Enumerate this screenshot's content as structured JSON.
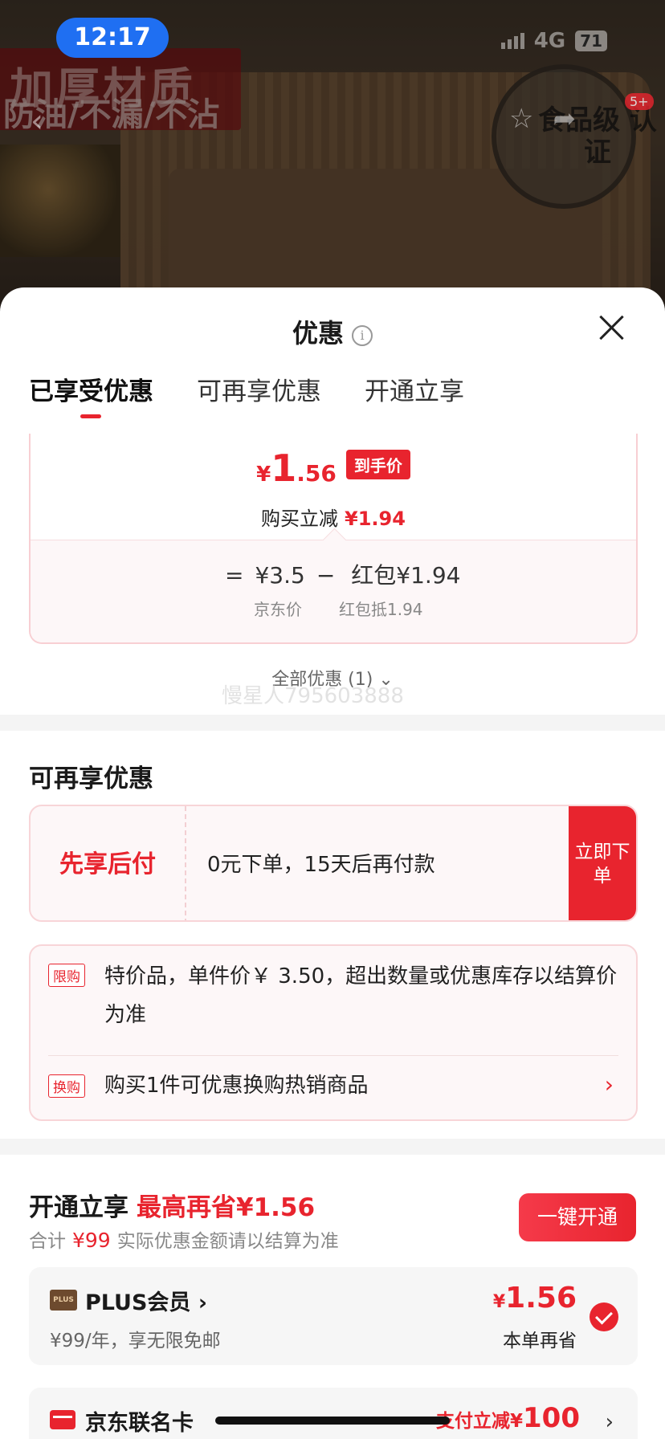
{
  "status_bar": {
    "time": "12:17",
    "network": "4G",
    "battery": "71"
  },
  "product_bg": {
    "banner_line1": "加厚材质",
    "banner_line2": "防油/不漏/不沾",
    "seal_text": "食品级 认证",
    "cart_badge": "5+"
  },
  "sheet": {
    "title": "优惠",
    "tabs": [
      "已享受优惠",
      "可再享优惠",
      "开通立享"
    ]
  },
  "price_card": {
    "currency": "¥",
    "price_int": "1",
    "price_dec": ".56",
    "price_tag": "到手价",
    "reduce_label": "购买立减",
    "reduce_value": "¥1.94",
    "formula_eq": "=",
    "formula_base": "¥3.5",
    "formula_minus": "−",
    "formula_redpacket_label": "红包",
    "formula_redpacket_value": "¥1.94",
    "sub_jd_price": "京东价",
    "sub_redpacket": "红包抵1.94"
  },
  "all_discount": "全部优惠 (1)",
  "watermark": "慢星人795603888",
  "more_discount": {
    "title": "可再享优惠",
    "paylater_label": "先享后付",
    "paylater_desc": "0元下单，15天后再付款",
    "paylater_btn": "立即下单",
    "tag_limit": "限购",
    "limit_text": "特价品，单件价￥ 3.50，超出数量或优惠库存以结算价为准",
    "tag_exchange": "换购",
    "exchange_text": "购买1件可优惠换购热销商品"
  },
  "open_section": {
    "title": "开通立享",
    "save": "最高再省¥1.56",
    "sub_prefix": "合计",
    "sub_amount": "¥99",
    "sub_suffix": "实际优惠金额请以结算为准",
    "btn": "一键开通"
  },
  "plus": {
    "logo": "PLUS",
    "name": "PLUS会员",
    "desc": "¥99/年，享无限免邮",
    "currency": "¥",
    "price": "1.56",
    "save_label": "本单再省"
  },
  "card2": {
    "name": "京东联名卡",
    "offer_prefix": "支付立减¥",
    "offer_value": "100"
  }
}
